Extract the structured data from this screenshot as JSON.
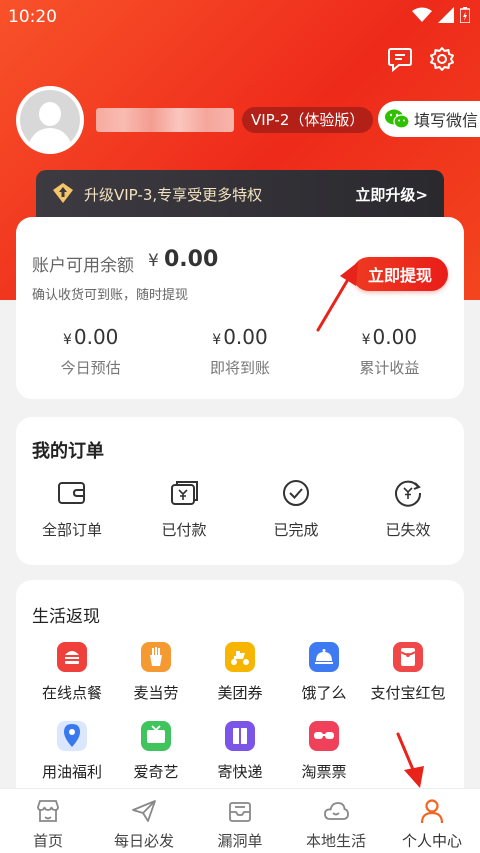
{
  "status_bar": {
    "time": "10:20"
  },
  "header": {
    "vip_badge": "VIP-2（体验版）",
    "wechat_button": "填写微信"
  },
  "vip_banner": {
    "text": "升级VIP-3,专享受更多特权",
    "link": "立即升级>"
  },
  "balance_card": {
    "label": "账户可用余额",
    "currency": "¥",
    "amount": "0.00",
    "subtitle": "确认收货可到账，随时提现",
    "withdraw_button": "立即提现",
    "stats": [
      {
        "currency": "¥",
        "value": "0.00",
        "label": "今日预估"
      },
      {
        "currency": "¥",
        "value": "0.00",
        "label": "即将到账"
      },
      {
        "currency": "¥",
        "value": "0.00",
        "label": "累计收益"
      }
    ]
  },
  "orders": {
    "title": "我的订单",
    "items": [
      {
        "label": "全部订单",
        "icon": "wallet-icon"
      },
      {
        "label": "已付款",
        "icon": "paid-icon"
      },
      {
        "label": "已完成",
        "icon": "check-circle-icon"
      },
      {
        "label": "已失效",
        "icon": "expired-icon"
      }
    ]
  },
  "life": {
    "title": "生活返现",
    "items": [
      {
        "label": "在线点餐",
        "icon": "burger-icon",
        "color": "#f0403c"
      },
      {
        "label": "麦当劳",
        "icon": "fries-icon",
        "color": "#f59a33"
      },
      {
        "label": "美团券",
        "icon": "scooter-icon",
        "color": "#f7b500"
      },
      {
        "label": "饿了么",
        "icon": "cloche-icon",
        "color": "#3e7bf2"
      },
      {
        "label": "支付宝红包",
        "icon": "red-envelope-icon",
        "color": "#f04848"
      },
      {
        "label": "用油福利",
        "icon": "map-pin-icon",
        "color": "#3a78ee"
      },
      {
        "label": "爱奇艺",
        "icon": "tv-icon",
        "color": "#3fc45e"
      },
      {
        "label": "寄快递",
        "icon": "package-icon",
        "color": "#7a55e8"
      },
      {
        "label": "淘票票",
        "icon": "glasses-icon",
        "color": "#f0405a"
      }
    ]
  },
  "tabbar": {
    "items": [
      {
        "label": "首页",
        "icon": "shop-icon"
      },
      {
        "label": "每日必发",
        "icon": "paper-plane-icon"
      },
      {
        "label": "漏洞单",
        "icon": "tray-icon"
      },
      {
        "label": "本地生活",
        "icon": "cloud-icon"
      },
      {
        "label": "个人中心",
        "icon": "person-icon"
      }
    ],
    "active_index": 4
  },
  "colors": {
    "brand_red": "#ee2a1a",
    "active_tab": "#f26522"
  }
}
